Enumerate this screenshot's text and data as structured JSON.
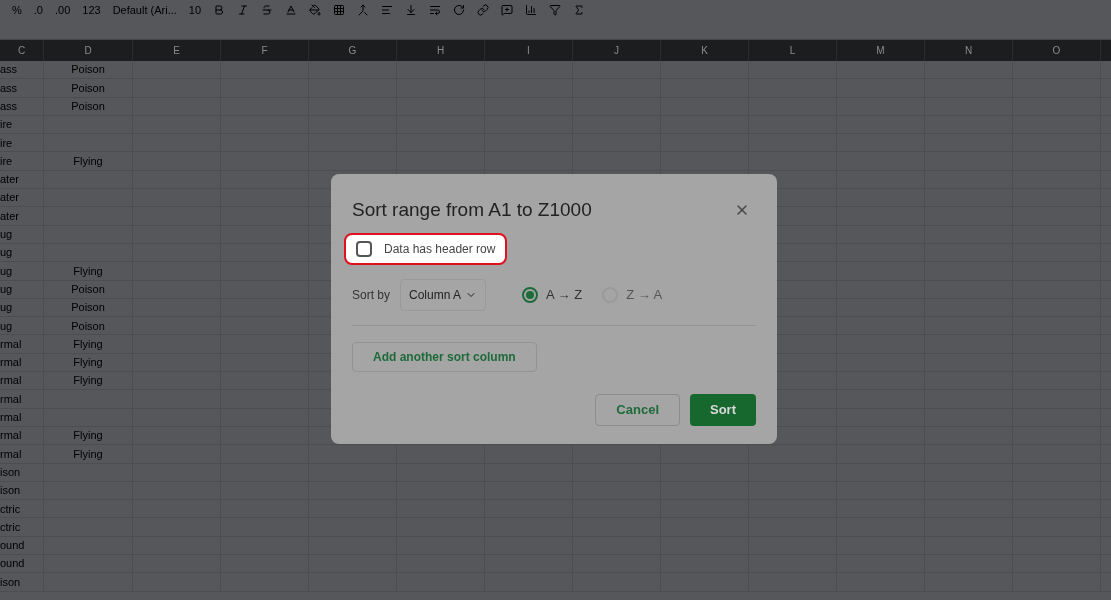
{
  "toolbar": {
    "items": [
      "%",
      ".0",
      ".00",
      "123",
      "Default (Ari...",
      "10"
    ]
  },
  "columns": [
    "C",
    "D",
    "E",
    "F",
    "G",
    "H",
    "I",
    "J",
    "K",
    "L",
    "M",
    "N",
    "O"
  ],
  "rows": [
    {
      "c": "ass",
      "d": "Poison"
    },
    {
      "c": "ass",
      "d": "Poison"
    },
    {
      "c": "ass",
      "d": "Poison"
    },
    {
      "c": "ire"
    },
    {
      "c": "ire"
    },
    {
      "c": "ire",
      "d": "Flying"
    },
    {
      "c": "ater"
    },
    {
      "c": "ater"
    },
    {
      "c": "ater"
    },
    {
      "c": "ug"
    },
    {
      "c": "ug"
    },
    {
      "c": "ug",
      "d": "Flying"
    },
    {
      "c": "ug",
      "d": "Poison"
    },
    {
      "c": "ug",
      "d": "Poison"
    },
    {
      "c": "ug",
      "d": "Poison"
    },
    {
      "c": "rmal",
      "d": "Flying"
    },
    {
      "c": "rmal",
      "d": "Flying"
    },
    {
      "c": "rmal",
      "d": "Flying"
    },
    {
      "c": "rmal"
    },
    {
      "c": "rmal"
    },
    {
      "c": "rmal",
      "d": "Flying"
    },
    {
      "c": "rmal",
      "d": "Flying"
    },
    {
      "c": "ison"
    },
    {
      "c": "ison"
    },
    {
      "c": "ctric"
    },
    {
      "c": "ctric"
    },
    {
      "c": "ound"
    },
    {
      "c": "ound"
    },
    {
      "c": "ison"
    }
  ],
  "dialog": {
    "title": "Sort range from A1 to Z1000",
    "header_row": {
      "label": "Data has header row",
      "checked": false,
      "highlighted": true
    },
    "sort_by": {
      "label": "Sort by",
      "value": "Column A"
    },
    "orders": [
      {
        "label": "A → Z",
        "selected": true
      },
      {
        "label": "Z → A",
        "selected": false
      }
    ],
    "add_button": "Add another sort column",
    "buttons": [
      {
        "label": "Cancel",
        "kind": "secondary"
      },
      {
        "label": "Sort",
        "kind": "primary"
      }
    ]
  }
}
